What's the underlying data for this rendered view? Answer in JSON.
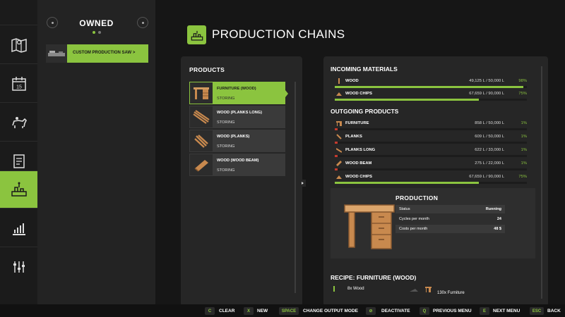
{
  "owned_panel": {
    "title": "OWNED",
    "production_item": "CUSTOM PRODUCTION SAW >"
  },
  "header": {
    "title": "PRODUCTION CHAINS"
  },
  "products": {
    "title": "PRODUCTS",
    "items": [
      {
        "name": "FURNITURE (WOOD)",
        "state": "STORING",
        "selected": true
      },
      {
        "name": "WOOD (PLANKS LONG)",
        "state": "STORING"
      },
      {
        "name": "WOOD (PLANKS)",
        "state": "STORING"
      },
      {
        "name": "WOOD (WOOD BEAM)",
        "state": "STORING"
      }
    ]
  },
  "incoming": {
    "title": "INCOMING MATERIALS",
    "rows": [
      {
        "name": "WOOD",
        "value": "49,125 L / 50,000 L",
        "pct": "98%",
        "fill": 0.98
      },
      {
        "name": "WOOD CHIPS",
        "value": "67,659 L / 90,000 L",
        "pct": "75%",
        "fill": 0.75
      }
    ]
  },
  "outgoing": {
    "title": "OUTGOING PRODUCTS",
    "rows": [
      {
        "name": "FURNITURE",
        "value": "858 L / 50,000 L",
        "pct": "1%",
        "fill": 0.01
      },
      {
        "name": "PLANKS",
        "value": "609 L / 50,000 L",
        "pct": "1%",
        "fill": 0.01
      },
      {
        "name": "PLANKS LONG",
        "value": "622 L / 33,000 L",
        "pct": "1%",
        "fill": 0.01
      },
      {
        "name": "WOOD BEAM",
        "value": "275 L / 22,000 L",
        "pct": "1%",
        "fill": 0.01
      },
      {
        "name": "WOOD CHIPS",
        "value": "67,659 L / 90,000 L",
        "pct": "75%",
        "fill": 0.75
      }
    ]
  },
  "production": {
    "title": "PRODUCTION",
    "status_label": "Status",
    "status_value": "Running",
    "cycles_label": "Cycles per month",
    "cycles_value": "24",
    "costs_label": "Costs per month",
    "costs_value": "48 $"
  },
  "recipe": {
    "title": "RECIPE: FURNITURE (WOOD)",
    "input": "8x Wood",
    "output": "130x Furniture"
  },
  "footer": {
    "keys": [
      {
        "key": "C",
        "label": "CLEAR"
      },
      {
        "key": "X",
        "label": "NEW"
      },
      {
        "key": "SPACE",
        "label": "CHANGE OUTPUT MODE"
      },
      {
        "key": "⊘",
        "label": "DEACTIVATE"
      },
      {
        "key": "Q",
        "label": "PREVIOUS MENU"
      },
      {
        "key": "E",
        "label": "NEXT MENU"
      },
      {
        "key": "ESC",
        "label": "BACK"
      }
    ]
  },
  "colors": {
    "accent": "#8bc43f",
    "low_bar": "#c43a2e",
    "panel": "#262626",
    "background": "#161616"
  },
  "nav_icons": [
    "map-icon",
    "calendar-icon",
    "animals-icon",
    "contracts-icon",
    "production-icon",
    "statistics-icon",
    "settings-icon"
  ]
}
